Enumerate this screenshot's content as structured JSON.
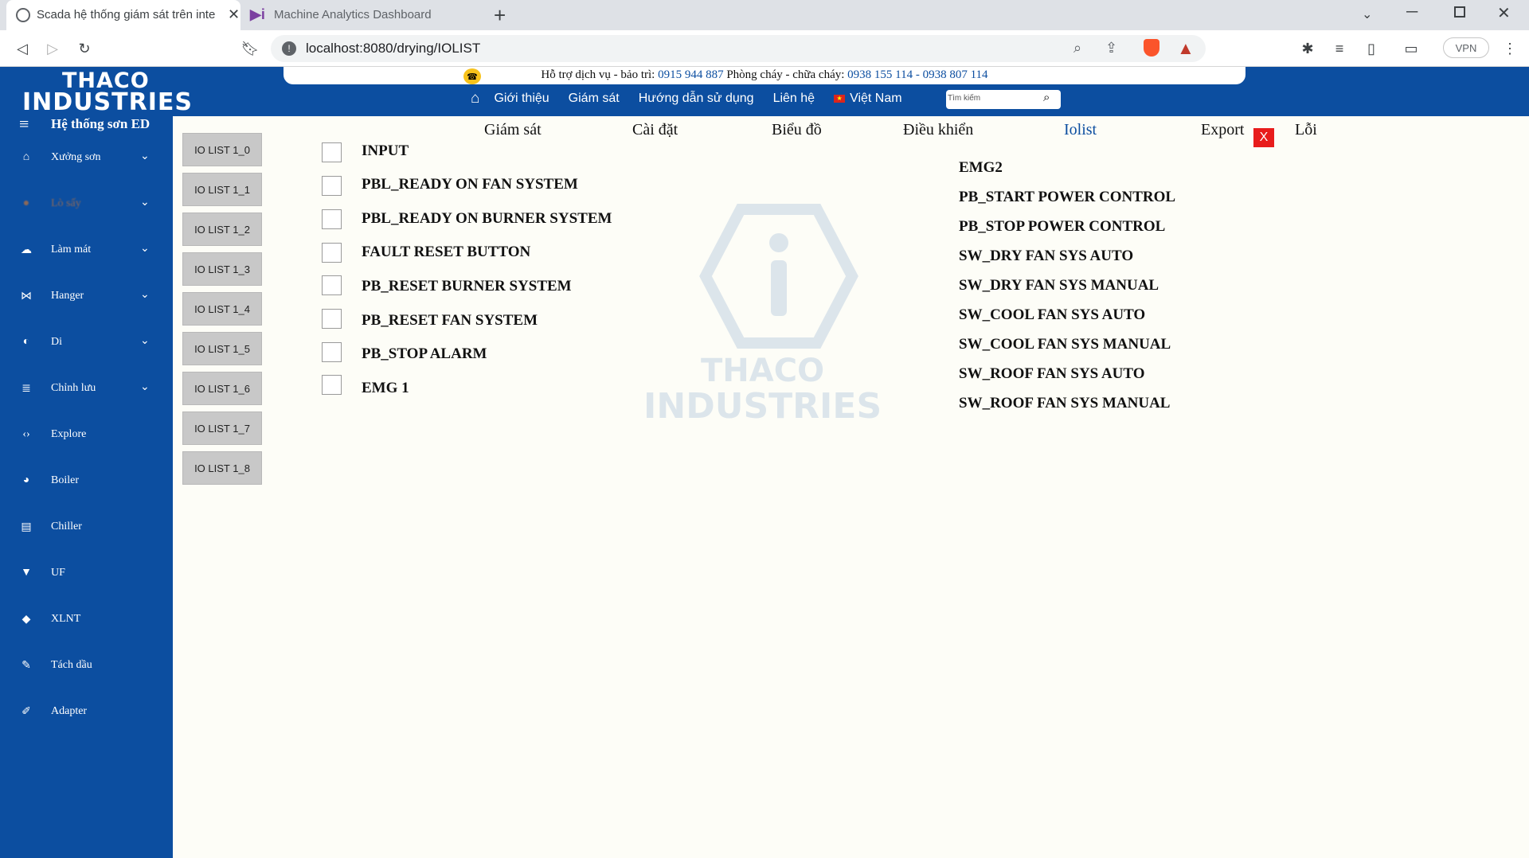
{
  "browser": {
    "tabs": [
      {
        "title": "Scada hệ thống giám sát trên inte",
        "active": true
      },
      {
        "title": "Machine Analytics Dashboard",
        "active": false
      }
    ],
    "url": "localhost:8080/drying/IOLIST",
    "vpn_label": "VPN"
  },
  "header": {
    "logo_line1": "THACO",
    "logo_line2": "INDUSTRIES",
    "hotline_prefix": "Hỗ trợ dịch vụ - bảo trì: ",
    "hotline_phone1": "0915 944 887",
    "hotline_mid": "  Phòng cháy - chữa cháy: ",
    "hotline_phone2": "0938 155 114 - 0938 807 114",
    "nav": [
      "Giới thiệu",
      "Giám sát",
      "Hướng dẫn sử dụng",
      "Liên hệ",
      "Việt Nam"
    ],
    "search_placeholder": "Tìm kiếm"
  },
  "sidebar": {
    "title": "Hệ thống sơn ED",
    "items": [
      {
        "label": "Xưởng sơn",
        "icon": "home-icon",
        "expandable": true
      },
      {
        "label": "Lò sấy",
        "icon": "fire-icon",
        "expandable": true
      },
      {
        "label": "Làm mát",
        "icon": "cloud-icon",
        "expandable": true
      },
      {
        "label": "Hanger",
        "icon": "hanger-icon",
        "expandable": true
      },
      {
        "label": "Di",
        "icon": "water-drop-icon",
        "expandable": true
      },
      {
        "label": "Chỉnh lưu",
        "icon": "database-icon",
        "expandable": true
      },
      {
        "label": "Explore",
        "icon": "code-icon",
        "expandable": false
      },
      {
        "label": "Boiler",
        "icon": "boiler-icon",
        "expandable": false
      },
      {
        "label": "Chiller",
        "icon": "chiller-icon",
        "expandable": false
      },
      {
        "label": "UF",
        "icon": "filter-icon",
        "expandable": false
      },
      {
        "label": "XLNT",
        "icon": "paint-bucket-icon",
        "expandable": false
      },
      {
        "label": "Tách dầu",
        "icon": "eyedropper-icon",
        "expandable": false
      },
      {
        "label": "Adapter",
        "icon": "pencil-icon",
        "expandable": false
      }
    ]
  },
  "io_lists": [
    "IO LIST 1_0",
    "IO LIST 1_1",
    "IO LIST 1_2",
    "IO LIST 1_3",
    "IO LIST 1_4",
    "IO LIST 1_5",
    "IO LIST 1_6",
    "IO LIST 1_7",
    "IO LIST 1_8"
  ],
  "content_tabs": [
    "Giám sát",
    "Cài đặt",
    "Biểu đồ",
    "Điều khiển",
    "Iolist",
    "Export",
    "Lỗi"
  ],
  "active_tab": "Iolist",
  "close_label": "X",
  "watermark": {
    "line1": "THACO",
    "line2": "INDUSTRIES"
  },
  "inputs": [
    "INPUT",
    "PBL_READY ON FAN SYSTEM",
    "PBL_READY ON BURNER SYSTEM",
    "FAULT RESET BUTTON",
    "PB_RESET BURNER SYSTEM",
    "PB_RESET FAN SYSTEM",
    "PB_STOP ALARM",
    "EMG 1"
  ],
  "outputs": [
    "EMG2",
    "PB_START POWER CONTROL",
    "PB_STOP POWER CONTROL",
    "SW_DRY FAN SYS AUTO",
    "SW_DRY FAN SYS MANUAL",
    "SW_COOL FAN SYS AUTO",
    "SW_COOL FAN SYS MANUAL",
    "SW_ROOF FAN SYS AUTO",
    "SW_ROOF FAN SYS MANUAL"
  ],
  "colors": {
    "brand": "#0c4ea0",
    "close": "#e81c1c",
    "hotline_icon": "#f7c21b"
  }
}
